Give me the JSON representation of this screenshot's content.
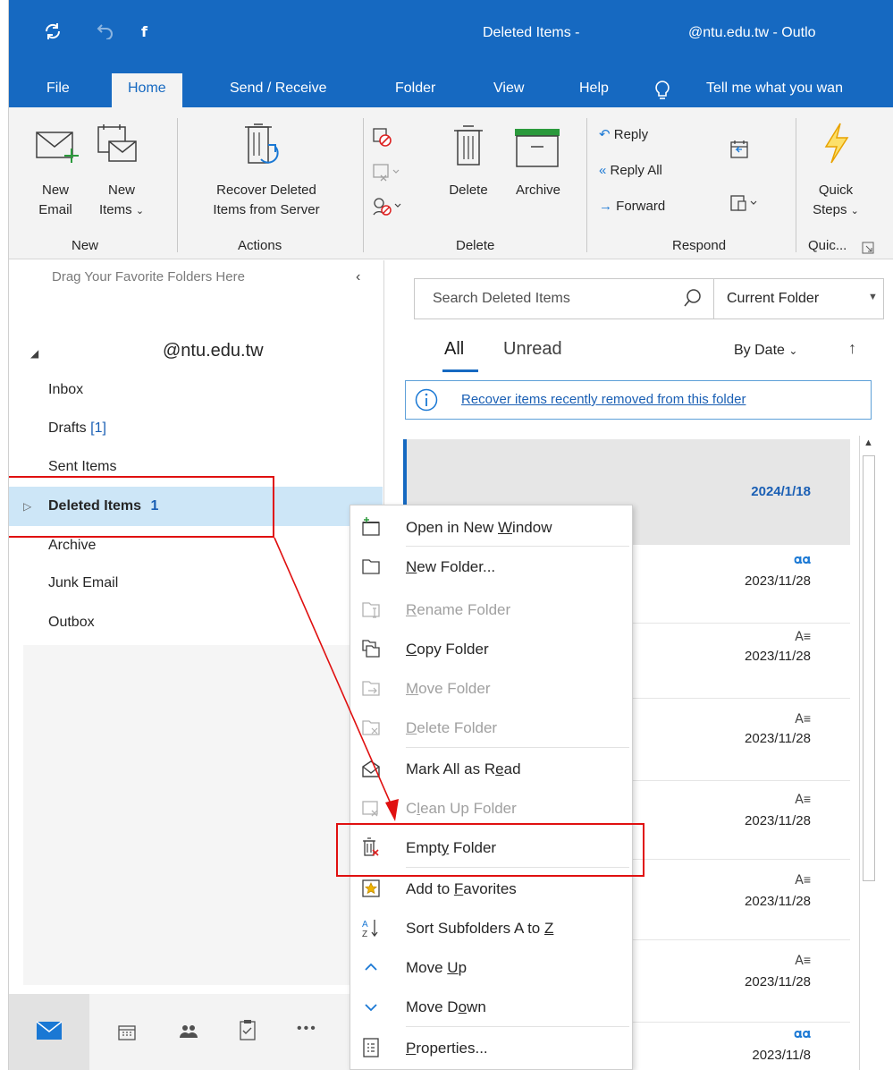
{
  "window": {
    "title_folder": "Deleted Items -",
    "title_account": "@ntu.edu.tw  -  Outlo"
  },
  "ribbon_tabs": [
    "File",
    "Home",
    "Send / Receive",
    "Folder",
    "View",
    "Help"
  ],
  "tell_me": "Tell me what you wan",
  "ribbon": {
    "new_email": [
      "New",
      "Email"
    ],
    "new_items": [
      "New",
      "Items"
    ],
    "recover_deleted": [
      "Recover Deleted",
      "Items from Server"
    ],
    "delete": "Delete",
    "archive": "Archive",
    "reply": "Reply",
    "reply_all": "Reply All",
    "forward": "Forward",
    "quick_steps": [
      "Quick",
      "Steps"
    ],
    "groups": {
      "new": "New",
      "actions": "Actions",
      "delete": "Delete",
      "respond": "Respond",
      "quick": "Quic..."
    }
  },
  "folder_pane": {
    "favorites_hint": "Drag Your Favorite Folders Here",
    "account": "@ntu.edu.tw",
    "folders": {
      "inbox": "Inbox",
      "drafts": "Drafts",
      "drafts_count": "[1]",
      "sent": "Sent Items",
      "deleted": "Deleted Items",
      "deleted_count": "1",
      "archive": "Archive",
      "junk": "Junk Email",
      "outbox": "Outbox"
    }
  },
  "message_list": {
    "search_placeholder": "Search Deleted Items",
    "scope": "Current Folder",
    "filter_all": "All",
    "filter_unread": "Unread",
    "sort": "By Date",
    "recover_link": "Recover items recently removed from this folder",
    "dates": [
      "2024/1/18",
      "2023/11/28",
      "2023/11/28",
      "2023/11/28",
      "2023/11/28",
      "2023/11/28",
      "2023/11/28",
      "2023/11/8"
    ]
  },
  "context_menu": {
    "open_new_window": [
      "Open in New ",
      "W",
      "indow"
    ],
    "new_folder": [
      "",
      "N",
      "ew Folder..."
    ],
    "rename_folder": [
      "",
      "R",
      "ename Folder"
    ],
    "copy_folder": [
      "",
      "C",
      "opy Folder"
    ],
    "move_folder": [
      "",
      "M",
      "ove Folder"
    ],
    "delete_folder": [
      "",
      "D",
      "elete Folder"
    ],
    "mark_all_read": [
      "Mark All as R",
      "e",
      "ad"
    ],
    "clean_up_folder": [
      "C",
      "l",
      "ean Up Folder"
    ],
    "empty_folder": [
      "Empt",
      "y",
      " Folder"
    ],
    "add_favorites": [
      "Add to ",
      "F",
      "avorites"
    ],
    "sort_subfolders": [
      "Sort Subfolders A to ",
      "Z",
      ""
    ],
    "move_up": [
      "Move ",
      "U",
      "p"
    ],
    "move_down": [
      "Move D",
      "o",
      "wn"
    ],
    "properties": [
      "",
      "P",
      "roperties..."
    ]
  },
  "colors": {
    "accent": "#1669c1",
    "selection": "#cde6f7",
    "annotation": "#e01010"
  }
}
